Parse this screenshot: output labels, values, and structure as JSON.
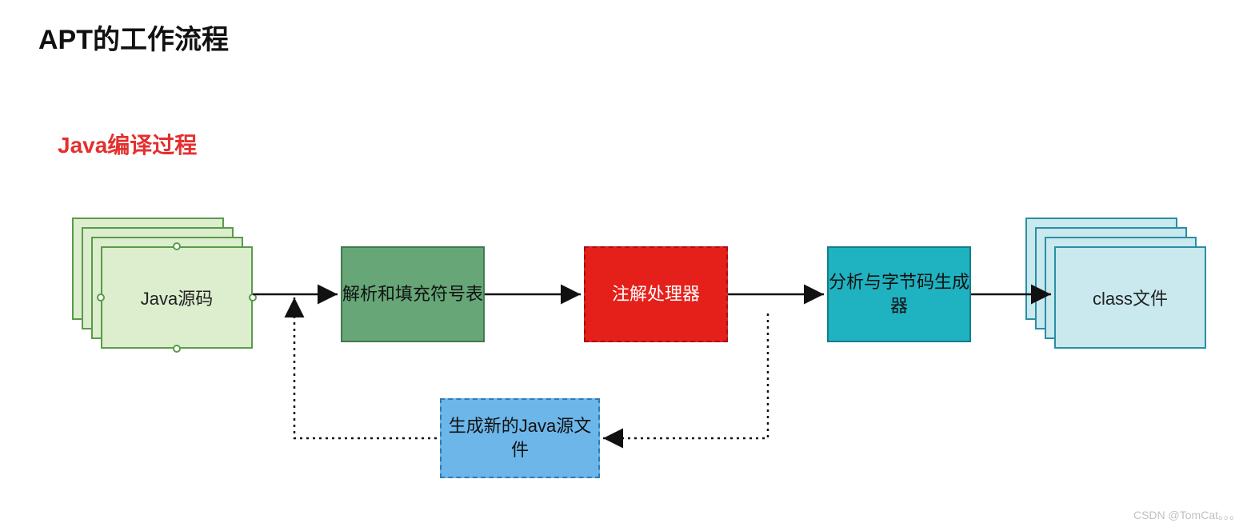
{
  "title": "APT的工作流程",
  "subtitle": "Java编译过程",
  "nodes": {
    "source": {
      "label": "Java源码"
    },
    "parse": {
      "label": "解析和填充符号表"
    },
    "annot": {
      "label": "注解处理器"
    },
    "analyze": {
      "label": "分析与字节码生成器"
    },
    "classf": {
      "label": "class文件"
    },
    "newsrc": {
      "label": "生成新的Java源文件"
    }
  },
  "watermark": "CSDN @TomCat。。。"
}
